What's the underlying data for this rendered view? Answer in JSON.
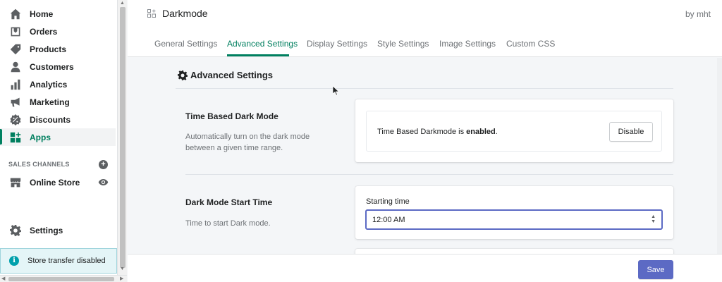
{
  "sidebar": {
    "items": [
      {
        "label": "Home",
        "icon": "home-icon"
      },
      {
        "label": "Orders",
        "icon": "orders-icon"
      },
      {
        "label": "Products",
        "icon": "tag-icon"
      },
      {
        "label": "Customers",
        "icon": "person-icon"
      },
      {
        "label": "Analytics",
        "icon": "bar-chart-icon"
      },
      {
        "label": "Marketing",
        "icon": "megaphone-icon"
      },
      {
        "label": "Discounts",
        "icon": "discount-icon"
      },
      {
        "label": "Apps",
        "icon": "apps-icon",
        "active": true
      }
    ],
    "sales_channels_heading": "SALES CHANNELS",
    "online_store": "Online Store",
    "settings": "Settings",
    "store_transfer": "Store transfer disabled"
  },
  "header": {
    "app_title": "Darkmode",
    "author": "by mht"
  },
  "tabs": [
    {
      "label": "General Settings"
    },
    {
      "label": "Advanced Settings",
      "active": true
    },
    {
      "label": "Display Settings"
    },
    {
      "label": "Style Settings"
    },
    {
      "label": "Image Settings"
    },
    {
      "label": "Custom CSS"
    }
  ],
  "panel": {
    "title": "Advanced Settings"
  },
  "time_based": {
    "title": "Time Based Dark Mode",
    "description": "Automatically turn on the dark mode between a given time range.",
    "status_prefix": "Time Based Darkmode is ",
    "status_value": "enabled",
    "status_suffix": ".",
    "button": "Disable"
  },
  "start_time": {
    "title": "Dark Mode Start Time",
    "description": "Time to start Dark mode.",
    "field_label": "Starting time",
    "selected_value": "12:00 AM"
  },
  "footer": {
    "save": "Save"
  },
  "colors": {
    "accent": "#008060",
    "primary_button": "#5c6ac4",
    "info_banner": "#e4f5f7"
  }
}
